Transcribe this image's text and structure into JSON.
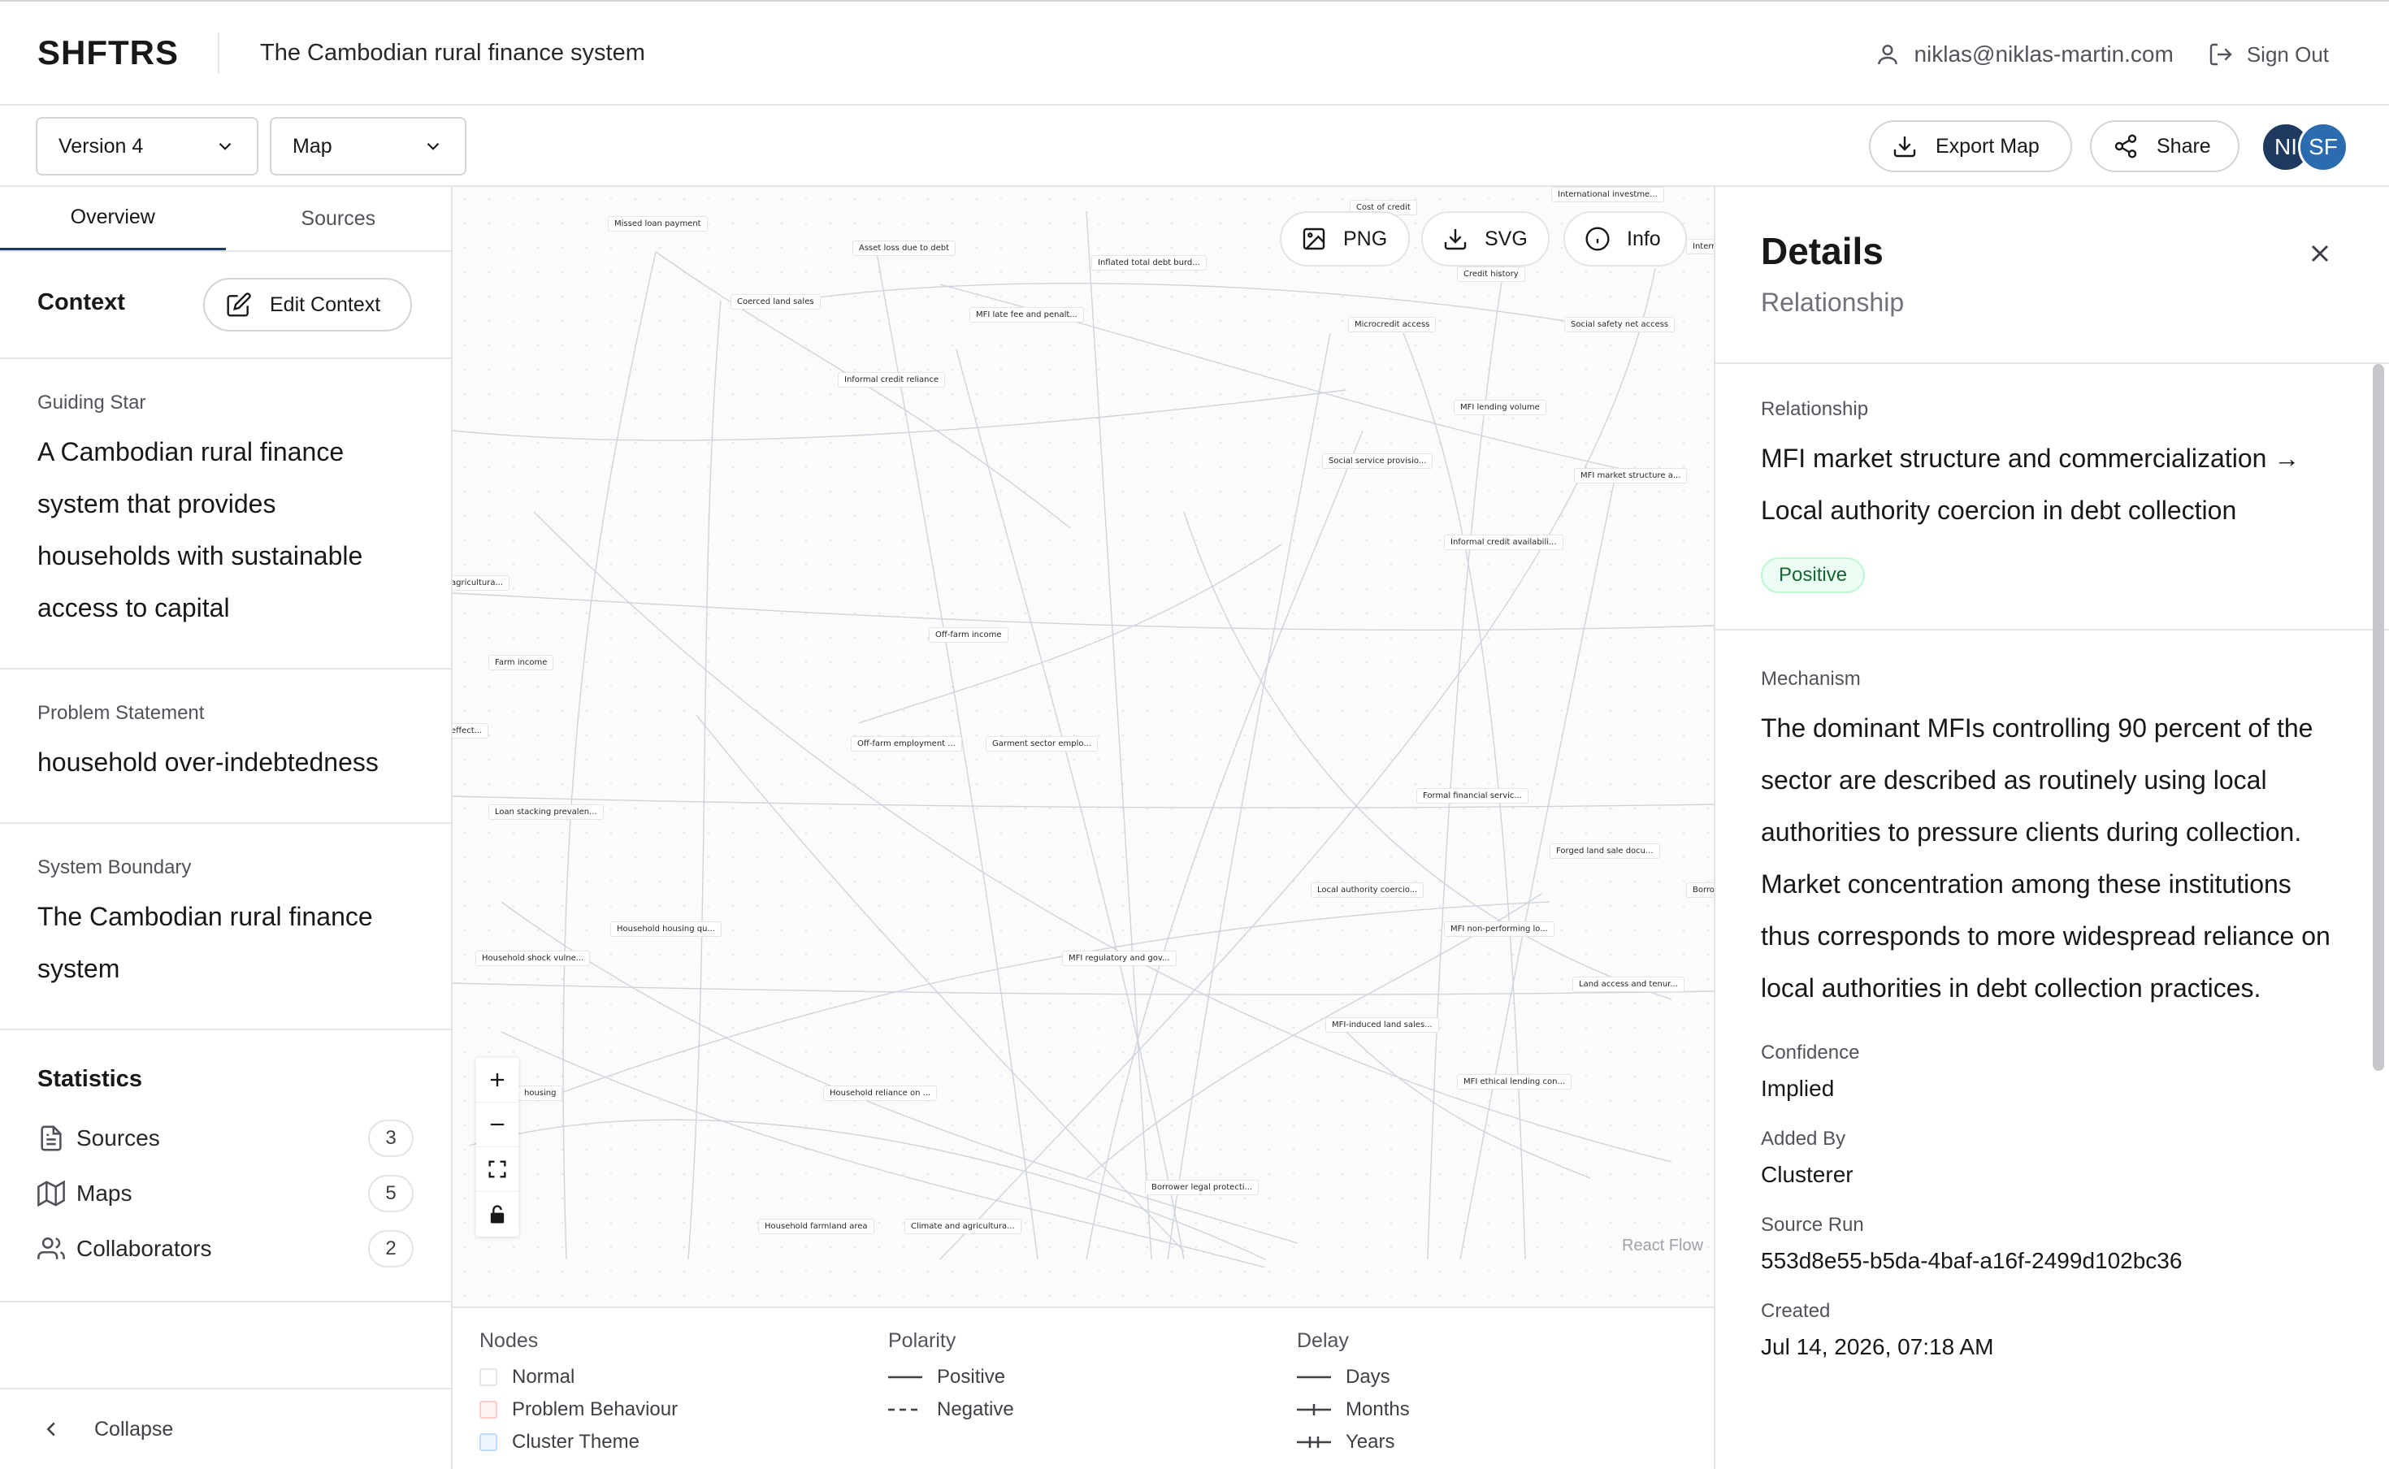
{
  "header": {
    "logo": "SHFTRS",
    "title": "The Cambodian rural finance system",
    "user_email": "niklas@niklas-martin.com",
    "signout_label": "Sign Out"
  },
  "toolbar": {
    "version_select": "Version 4",
    "view_select": "Map",
    "export_label": "Export Map",
    "share_label": "Share",
    "avatars": [
      {
        "initials": "NI",
        "color": "#1e3a5f"
      },
      {
        "initials": "SF",
        "color": "#2b6cb0"
      }
    ]
  },
  "sidebar": {
    "tabs": [
      "Overview",
      "Sources"
    ],
    "context_title": "Context",
    "edit_context_label": "Edit Context",
    "guiding_star_label": "Guiding Star",
    "guiding_star": "A Cambodian rural finance system that provides households with sustainable access to capital",
    "problem_label": "Problem Statement",
    "problem": "household over-indebtedness",
    "boundary_label": "System Boundary",
    "boundary": "The Cambodian rural finance system",
    "stats_title": "Statistics",
    "stats": [
      {
        "label": "Sources",
        "count": "3",
        "icon": "document-icon"
      },
      {
        "label": "Maps",
        "count": "5",
        "icon": "map-icon"
      },
      {
        "label": "Collaborators",
        "count": "2",
        "icon": "users-icon"
      }
    ],
    "collapse_label": "Collapse"
  },
  "canvas": {
    "png_label": "PNG",
    "svg_label": "SVG",
    "info_label": "Info",
    "attribution": "React Flow",
    "nodes": [
      {
        "label": "Missed loan payment"
      },
      {
        "label": "Asset loss due to debt"
      },
      {
        "label": "Inflated total debt burd..."
      },
      {
        "label": "Coerced land sales"
      },
      {
        "label": "MFI late fee and penalt..."
      },
      {
        "label": "Cost of credit"
      },
      {
        "label": "International investme..."
      },
      {
        "label": "Credit history"
      },
      {
        "label": "Microcredit access"
      },
      {
        "label": "Social safety net access"
      },
      {
        "label": "Intern"
      },
      {
        "label": "Informal credit reliance"
      },
      {
        "label": "MFI lending volume"
      },
      {
        "label": "Social service provisio..."
      },
      {
        "label": "MFI market structure a..."
      },
      {
        "label": "Informal credit availabili..."
      },
      {
        "label": "agricultura..."
      },
      {
        "label": "Off-farm income"
      },
      {
        "label": "Farm income"
      },
      {
        "label": "effect..."
      },
      {
        "label": "Off-farm employment ..."
      },
      {
        "label": "Garment sector emplo..."
      },
      {
        "label": "Loan stacking prevalen..."
      },
      {
        "label": "Formal financial servic..."
      },
      {
        "label": "Forged land sale docu..."
      },
      {
        "label": "Local authority coercio..."
      },
      {
        "label": "Borro"
      },
      {
        "label": "Household housing qu..."
      },
      {
        "label": "Household shock vulne..."
      },
      {
        "label": "MFI non-performing lo..."
      },
      {
        "label": "MFI regulatory and gov..."
      },
      {
        "label": "Land access and tenur..."
      },
      {
        "label": "MFI-induced land sales..."
      },
      {
        "label": "housing"
      },
      {
        "label": "Household reliance on ..."
      },
      {
        "label": "MFI ethical lending con..."
      },
      {
        "label": "Borrower legal protecti..."
      },
      {
        "label": "Household farmland area"
      },
      {
        "label": "Climate and agricultura..."
      }
    ]
  },
  "legend": {
    "nodes_title": "Nodes",
    "nodes": [
      {
        "label": "Normal",
        "color": "#ffffff",
        "border": "#e4e4e7"
      },
      {
        "label": "Problem Behaviour",
        "color": "#fef2f2",
        "border": "#fecaca"
      },
      {
        "label": "Cluster Theme",
        "color": "#eff6ff",
        "border": "#bfdbfe"
      }
    ],
    "polarity_title": "Polarity",
    "polarity": [
      {
        "label": "Positive",
        "style": "solid"
      },
      {
        "label": "Negative",
        "style": "dashed"
      }
    ],
    "delay_title": "Delay",
    "delay": [
      {
        "label": "Days",
        "ticks": 0
      },
      {
        "label": "Months",
        "ticks": 1
      },
      {
        "label": "Years",
        "ticks": 2
      }
    ]
  },
  "details": {
    "title": "Details",
    "subtitle": "Relationship",
    "relationship_label": "Relationship",
    "relationship": "MFI market structure and commercialization → Local authority coercion in debt collection",
    "polarity_badge": "Positive",
    "mechanism_label": "Mechanism",
    "mechanism": "The dominant MFIs controlling 90 percent of the sector are described as routinely using local authorities to pressure clients during collection. Market concentration among these institutions thus corresponds to more widespread reliance on local authorities in debt collection practices.",
    "confidence_label": "Confidence",
    "confidence": "Implied",
    "added_by_label": "Added By",
    "added_by": "Clusterer",
    "source_run_label": "Source Run",
    "source_run": "553d8e55-b5da-4baf-a16f-2499d102bc36",
    "created_label": "Created",
    "created": "Jul 14, 2026, 07:18 AM"
  }
}
